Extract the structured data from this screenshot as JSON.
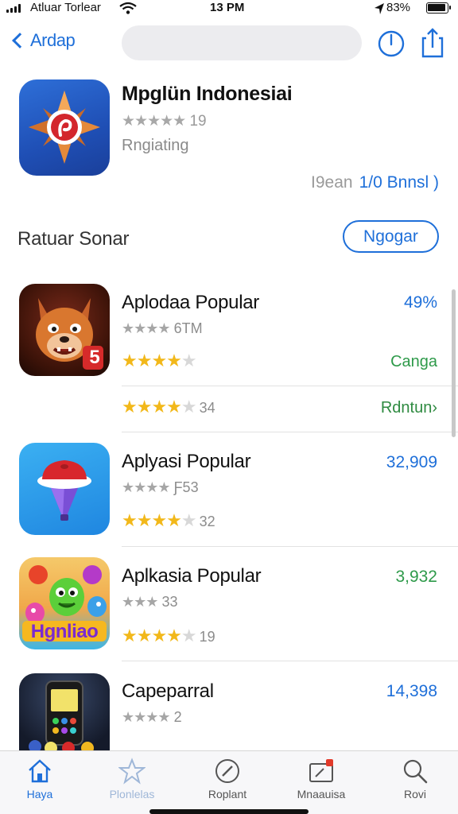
{
  "status_bar": {
    "carrier": "Atluar Torlear",
    "time": "13 PM",
    "battery": "83%"
  },
  "nav": {
    "back_label": "Ardap",
    "icons": [
      "power-icon",
      "share-icon"
    ]
  },
  "featured": {
    "title": "Mpglün Indonesiai",
    "stars": "★★★★★",
    "rating_count": "19",
    "subtitle": "Rngiating",
    "link_muted": "I9ean",
    "link": "1/0 Bnnsl )"
  },
  "section": {
    "title": "Ratuar Sonar",
    "button": "Ngogar"
  },
  "apps": [
    {
      "name": "Aplodaa Popular",
      "meta_stars": "★★★★",
      "meta_text": "6TM",
      "value": "49%",
      "row1_stars_filled": "★★★★",
      "row1_stars_empty": "★",
      "row1_count": "",
      "action1": "Canga",
      "row2_stars_filled": "★★★★",
      "row2_stars_empty": "★",
      "row2_count": "34",
      "action2": "Rdntun›"
    },
    {
      "name": "Aplyasi Popular",
      "meta_stars": "★★★★",
      "meta_text": "Ƒ53",
      "value": "32,909",
      "stars_filled": "★★★★",
      "stars_empty": "★",
      "count": "32"
    },
    {
      "name": "Aplkasia Popular",
      "meta_stars": "★★★",
      "meta_text": "33",
      "value": "3,932",
      "stars_filled": "★★★★",
      "stars_empty": "★",
      "count": "19"
    },
    {
      "name": "Capeparral",
      "meta_stars": "★★★★",
      "meta_text": "2",
      "value": "14,398"
    }
  ],
  "icon_texts": {
    "wolf_badge": "5",
    "game_title": "Hgnliao"
  },
  "tabs": [
    {
      "label": "Haya",
      "icon": "home-icon"
    },
    {
      "label": "Plonlelas",
      "icon": "star-icon"
    },
    {
      "label": "Roplant",
      "icon": "compass-icon"
    },
    {
      "label": "Mnaauisa",
      "icon": "updates-icon"
    },
    {
      "label": "Rovi",
      "icon": "search-icon"
    }
  ],
  "colors": {
    "accent": "#1e6fd9",
    "star": "#f2b81a",
    "green": "#2e9a4a"
  }
}
